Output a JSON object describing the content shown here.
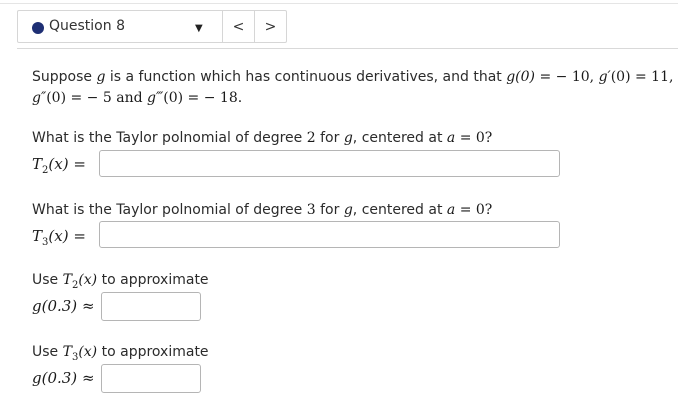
{
  "nav": {
    "question_label": "Question 8",
    "caret": "▼",
    "prev": "<",
    "next": ">"
  },
  "problem": {
    "line1_prefix": "Suppose ",
    "g": "g",
    "line1_mid": " is a function which has continuous derivatives, and that ",
    "g0": "g(0)",
    "eq": " = ",
    "v0": "− 10, ",
    "g1": "g′",
    "arg0": "(0)",
    "v1": " = 11,",
    "g2": "g″",
    "v2": " = − 5 and ",
    "g3": "g‴",
    "v3": " = − 18."
  },
  "q1": {
    "prompt_a": "What is the Taylor polnomial of degree ",
    "degree": "2",
    "prompt_b": " for ",
    "var": "g",
    "prompt_c": ", centered at ",
    "a": "a",
    "prompt_d": " = 0?",
    "lhs_T": "T",
    "lhs_sub": "2",
    "lhs_x": "(x)",
    "lhs_eq": " =",
    "value": ""
  },
  "q2": {
    "prompt_a": "What is the Taylor polnomial of degree ",
    "degree": "3",
    "prompt_b": " for ",
    "var": "g",
    "prompt_c": ", centered at ",
    "a": "a",
    "prompt_d": " = 0?",
    "lhs_T": "T",
    "lhs_sub": "3",
    "lhs_x": "(x)",
    "lhs_eq": " =",
    "value": ""
  },
  "q3": {
    "use": "Use ",
    "T": "T",
    "sub": "2",
    "x": "(x)",
    "rest": " to approximate",
    "lhs": "g(0.3)",
    "approx": " ≈",
    "value": ""
  },
  "q4": {
    "use": "Use ",
    "T": "T",
    "sub": "3",
    "x": "(x)",
    "rest": " to approximate",
    "lhs": "g(0.3)",
    "approx": " ≈",
    "value": ""
  }
}
